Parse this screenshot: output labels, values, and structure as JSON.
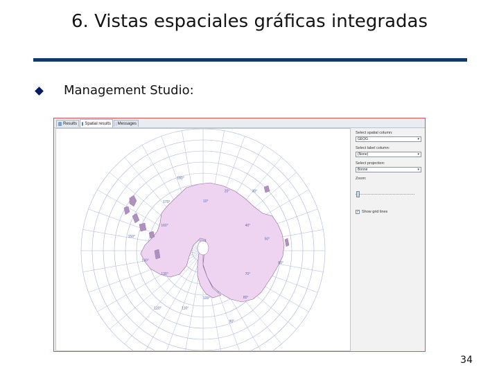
{
  "slide": {
    "title": "6. Vistas espaciales gráficas integradas",
    "bullet": "Management Studio:",
    "page_number": "34",
    "rule_color": "#0d3b66",
    "bullet_color": "#001a66"
  },
  "window": {
    "tabs": [
      {
        "label": "Results",
        "icon": "grid-icon"
      },
      {
        "label": "Spatial results",
        "icon": "globe-icon"
      },
      {
        "label": "Messages",
        "icon": "message-icon"
      }
    ],
    "active_tab": 1,
    "map": {
      "fill_color": "#efd4f2",
      "outline_color": "#8a6a9a",
      "grid_color": "#a8b4e0",
      "degree_labels": [
        "10°",
        "20°",
        "30°",
        "40°",
        "50°",
        "60°",
        "70°",
        "80°",
        "90°",
        "100°",
        "110°",
        "120°",
        "130°",
        "140°",
        "150°",
        "160°",
        "170°",
        "180°"
      ]
    },
    "panel": {
      "spatial_column_label": "Select spatial column:",
      "spatial_column_value": "GEOG",
      "label_column_label": "Select label column:",
      "label_column_value": "(None)",
      "projection_label": "Select projection:",
      "projection_value": "Bonne",
      "zoom_label": "Zoom:",
      "show_gridlines_label": "Show grid lines",
      "show_gridlines_checked": true
    }
  }
}
